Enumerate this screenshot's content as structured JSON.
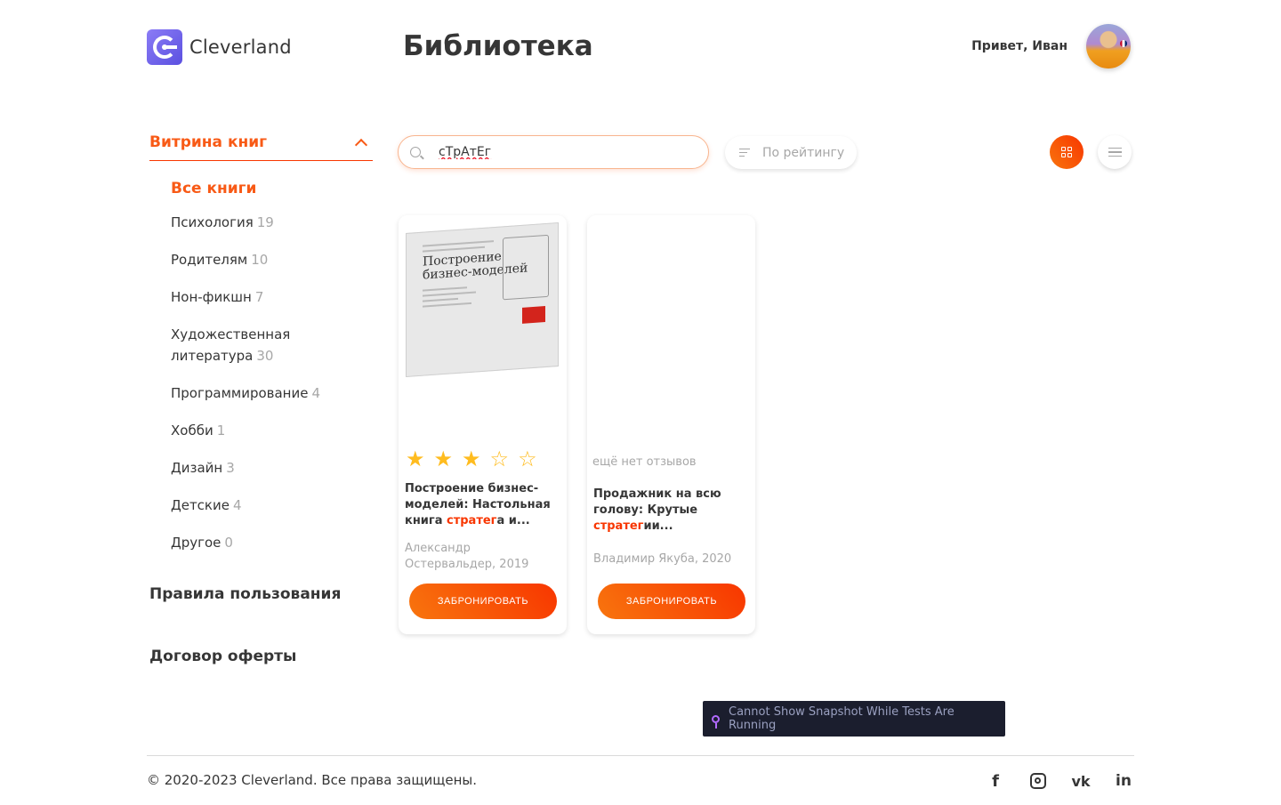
{
  "header": {
    "brand": "Cleverland",
    "title": "Библиотека",
    "greeting": "Привет, Иван"
  },
  "sidebar": {
    "showcase_title": "Витрина книг",
    "categories": [
      {
        "label": "Все книги",
        "count": ""
      },
      {
        "label": "Психология",
        "count": "19"
      },
      {
        "label": "Родителям",
        "count": "10"
      },
      {
        "label": "Нон-фикшн",
        "count": "7"
      },
      {
        "label": "Художественная литература",
        "count": "30"
      },
      {
        "label": "Программирование",
        "count": "4"
      },
      {
        "label": "Хобби",
        "count": "1"
      },
      {
        "label": "Дизайн",
        "count": "3"
      },
      {
        "label": "Детские",
        "count": "4"
      },
      {
        "label": "Другое",
        "count": "0"
      }
    ],
    "rules": "Правила пользования",
    "offer": "Договор оферты"
  },
  "toolbar": {
    "search_value": "сТрАтЕг",
    "sort_label": "По рейтингу"
  },
  "books": [
    {
      "rating": 3,
      "max_rating": 5,
      "title_before": "Построение бизнес-моделей: Настольная книга ",
      "title_hl": "стратег",
      "title_after": "а и...",
      "author": "Александр Остервальдер, 2019",
      "button": "ЗАБРОНИРОВАТЬ",
      "cover_title": "Построение бизнес-моделей"
    },
    {
      "no_reviews": "ещё нет отзывов",
      "title_before": "Продажник на всю голову: Крутые ",
      "title_hl": "стратег",
      "title_after": "ии...",
      "author": "Владимир Якуба, 2020",
      "button": "ЗАБРОНИРОВАТЬ"
    }
  ],
  "toast": "Cannot Show Snapshot While Tests Are Running",
  "footer": {
    "copyright": "© 2020-2023 Cleverland. Все права защищены.",
    "social": [
      "facebook-icon",
      "instagram-icon",
      "vk-icon",
      "linkedin-icon"
    ]
  },
  "colors": {
    "accent": "#f85a16",
    "accent_dark": "#f83600",
    "star": "#ffbc1f",
    "muted": "#a7a7a7",
    "text": "#363636"
  }
}
